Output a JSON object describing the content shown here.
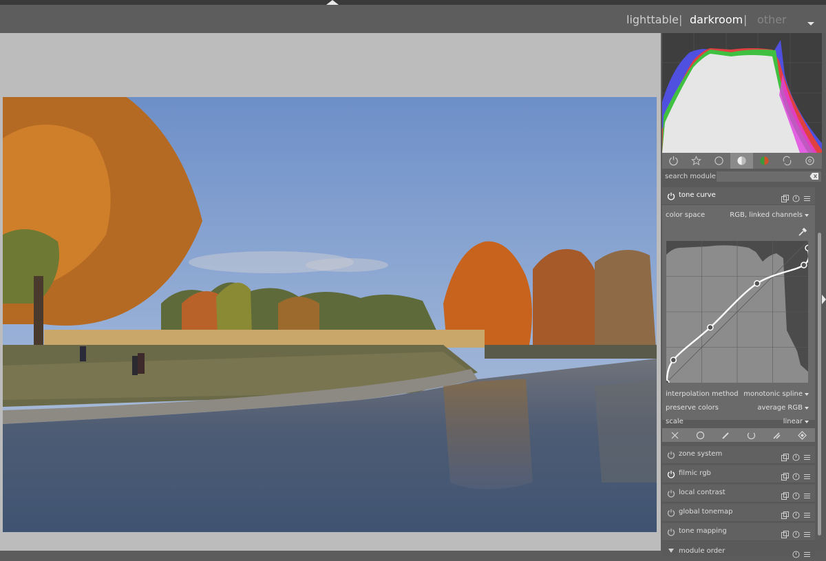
{
  "header": {
    "views": [
      "lighttable",
      "darkroom",
      "other"
    ],
    "separator": "|",
    "active_view": "darkroom"
  },
  "colors": {
    "background": "#5c5c5c",
    "center_background": "#bcbcbc",
    "panel": "#5a5a5a",
    "module_header": "#616161",
    "module_body": "#6a6a6a",
    "curve_line": "#ffffff"
  },
  "module_groups": {
    "icons": [
      "power-icon",
      "star-icon",
      "circle-icon",
      "tone-icon",
      "color-icon",
      "correct-icon",
      "effects-icon"
    ],
    "active_index": 3
  },
  "search": {
    "label": "search module",
    "value": "",
    "clear_icon": "backspace-icon"
  },
  "tone_curve": {
    "name": "tone curve",
    "enabled": true,
    "header_icons": [
      "presets-icon",
      "reset-icon",
      "menu-icon"
    ],
    "color_space": {
      "label": "color space",
      "value": "RGB, linked channels"
    },
    "interpolation_method": {
      "label": "interpolation method",
      "value": "monotonic spline"
    },
    "preserve_colors": {
      "label": "preserve colors",
      "value": "average RGB"
    },
    "scale": {
      "label": "scale",
      "value": "linear"
    },
    "picker_icon": "color-picker-icon",
    "curve_nodes": [
      [
        0.0,
        0.0
      ],
      [
        0.05,
        0.16
      ],
      [
        0.31,
        0.39
      ],
      [
        0.64,
        0.7
      ],
      [
        0.97,
        0.83
      ],
      [
        1.0,
        0.95
      ]
    ],
    "toolbar_icons": [
      "close-icon",
      "circle-icon",
      "brush-icon",
      "gradient-icon",
      "path-icon",
      "raster-icon"
    ]
  },
  "modules": [
    {
      "name": "zone system",
      "enabled": false
    },
    {
      "name": "filmic rgb",
      "enabled": true
    },
    {
      "name": "local contrast",
      "enabled": false
    },
    {
      "name": "global tonemap",
      "enabled": false
    },
    {
      "name": "tone mapping",
      "enabled": false
    }
  ],
  "module_order": {
    "label": "module order"
  }
}
